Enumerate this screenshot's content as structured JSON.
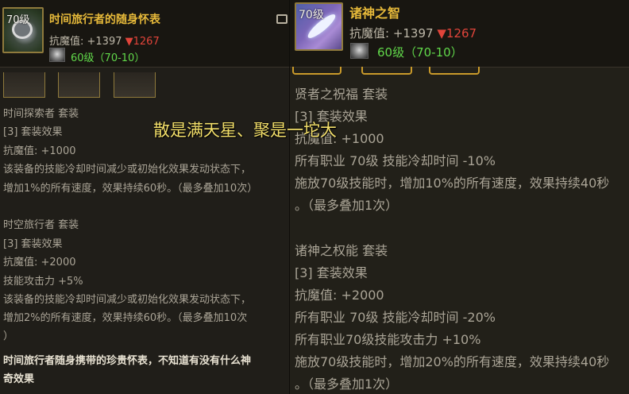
{
  "left_item": {
    "level_badge": "70级",
    "icon": "pocket-watch-icon",
    "name": "时间旅行者的随身怀表",
    "resist_label": "抗魔值: +1397",
    "resist_drop": "▼1267",
    "gem_icon": "gem-icon",
    "level_range": "60级（70-10）",
    "set_sections": [
      {
        "title": "时间探索者  套装",
        "effect_header": "[3] 套装效果",
        "lines": [
          "抗魔值: +1000",
          "该装备的技能冷却时间减少或初始化效果发动状态下，",
          "增加1%的所有速度，效果持续60秒。（最多叠加10次）"
        ]
      },
      {
        "title": "时空旅行者  套装",
        "effect_header": "[3] 套装效果",
        "lines": [
          "抗魔值: +2000",
          "技能攻击力 +5%",
          "该装备的技能冷却时间减少或初始化效果发动状态下，",
          "增加2%的所有速度，效果持续60秒。（最多叠加10次",
          "）"
        ]
      }
    ],
    "description_lines": [
      "时间旅行者随身携带的珍贵怀表，不知道有没有什么神",
      "奇效果"
    ]
  },
  "right_item": {
    "level_badge": "70级",
    "icon": "feather-icon",
    "name": "诸神之智",
    "resist_label": "抗魔值: +1397",
    "resist_drop": "▼1267",
    "gem_icon": "gem-icon",
    "level_range": "60级（70-10）",
    "set_sections": [
      {
        "title": "贤者之祝福  套装",
        "effect_header": "[3] 套装效果",
        "lines": [
          "抗魔值: +1000",
          "所有职业 70级 技能冷却时间 -10%",
          "施放70级技能时，增加10%的所有速度，效果持续40秒",
          "。（最多叠加1次）"
        ]
      },
      {
        "title": "诸神之权能  套装",
        "effect_header": "[3] 套装效果",
        "lines": [
          "抗魔值: +2000",
          "所有职业 70级 技能冷却时间 -20%",
          "所有职业70级技能攻击力 +10%",
          "施放70级技能时，增加20%的所有速度，效果持续40秒",
          "。（最多叠加1次）"
        ]
      }
    ]
  },
  "overlay_caption": "散是满天星、聚是一坨大",
  "colors": {
    "title_gold": "#e6b93a",
    "drop_red": "#e0443a",
    "level_green": "#61d84a",
    "caption_yellow": "#f3df6a"
  }
}
